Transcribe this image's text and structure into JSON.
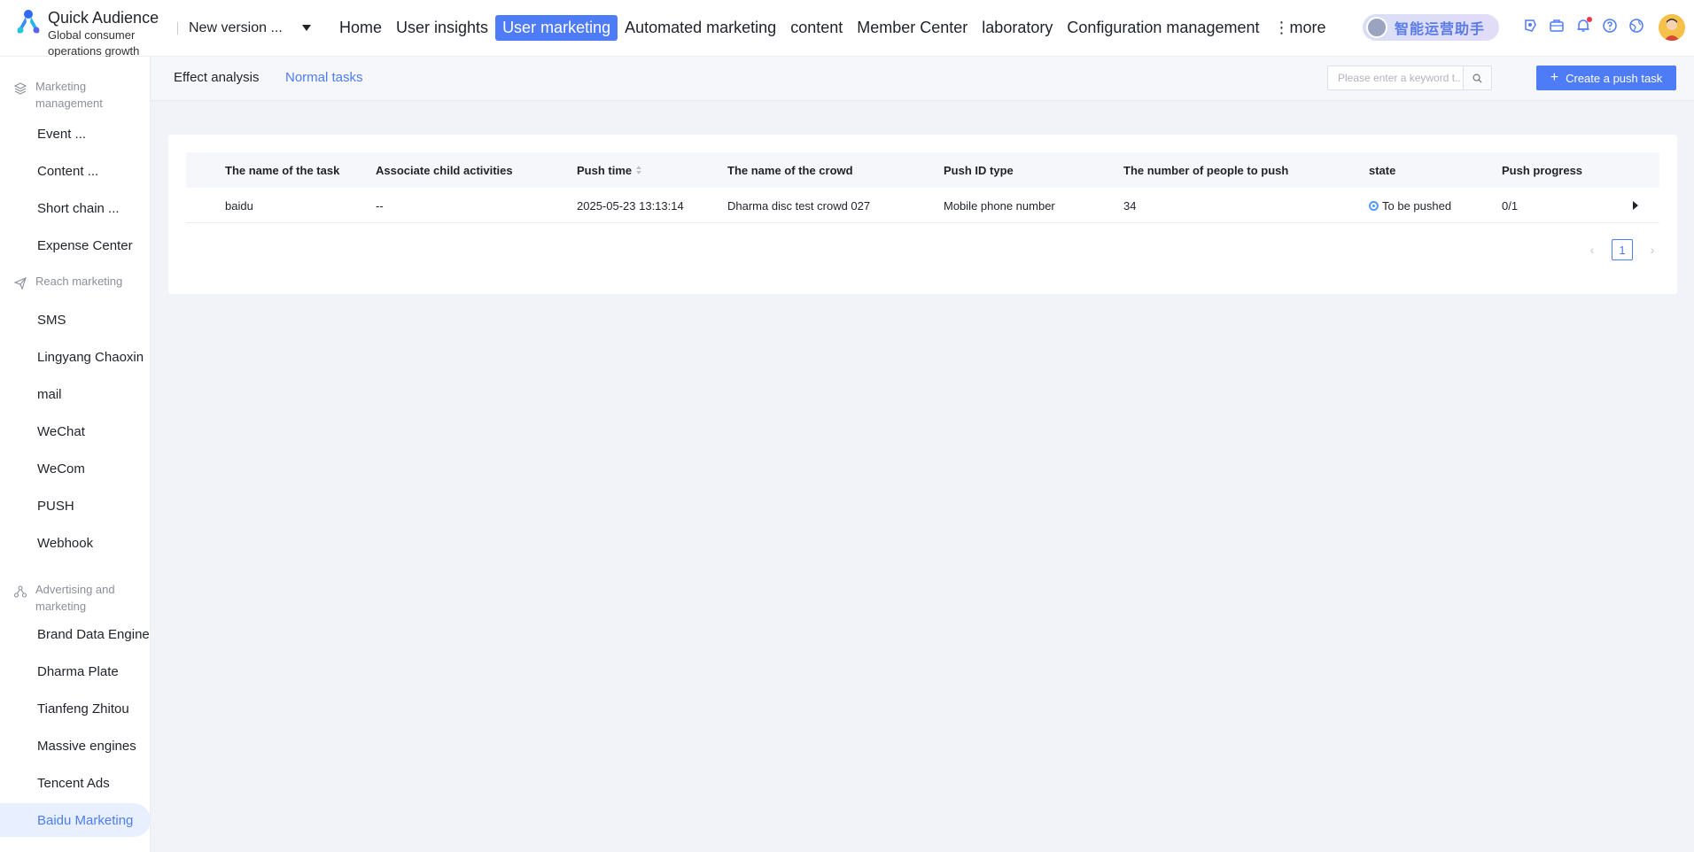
{
  "brand": {
    "title": "Quick Audience",
    "subtitle_line1": "Global consumer",
    "subtitle_line2": "operations growth"
  },
  "version_selector": {
    "value": "New version ..."
  },
  "nav": {
    "items": [
      "Home",
      "User insights",
      "User marketing",
      "Automated marketing",
      "content",
      "Member Center",
      "laboratory",
      "Configuration management"
    ],
    "active": "User marketing",
    "more_label": "⋮more"
  },
  "assistant": {
    "label": "智能运营助手"
  },
  "sidebar": {
    "groups": [
      {
        "title_line1": "Marketing",
        "title_line2": "management",
        "icon": "layers-icon"
      },
      {
        "title": "Reach marketing",
        "icon": "send-icon"
      },
      {
        "title_line1": "Advertising and",
        "title_line2": "marketing",
        "icon": "share-nodes-icon"
      }
    ],
    "items": [
      "Event ...",
      "Content ...",
      "Short chain ...",
      "Expense Center",
      "SMS",
      "Lingyang Chaoxin",
      "mail",
      "WeChat",
      "WeCom",
      "PUSH",
      "Webhook",
      "Brand Data Engine",
      "Dharma Plate",
      "Tianfeng Zhitou",
      "Massive engines",
      "Tencent Ads",
      "Baidu Marketing"
    ],
    "active": "Baidu Marketing"
  },
  "subnav": {
    "tab1": "Effect analysis",
    "tab2": "Normal tasks"
  },
  "search": {
    "placeholder": "Please enter a keyword t..."
  },
  "create_button": {
    "label": "Create a push task"
  },
  "table": {
    "headers": [
      "The name of the task",
      "Associate child activities",
      "Push time",
      "The name of the crowd",
      "Push ID type",
      "The number of people to push",
      "state",
      "Push progress"
    ],
    "rows": [
      {
        "name": "baidu",
        "child": "--",
        "time": "2025-05-23 13:13:14",
        "crowd": "Dharma disc test crowd 027",
        "id_type": "Mobile phone number",
        "count": "34",
        "state": "To be pushed",
        "progress": "0/1"
      }
    ]
  },
  "pagination": {
    "current": "1"
  },
  "colors": {
    "accent": "#4e7cf6",
    "state": "#4e9cf6",
    "notification": "#f2334b"
  }
}
